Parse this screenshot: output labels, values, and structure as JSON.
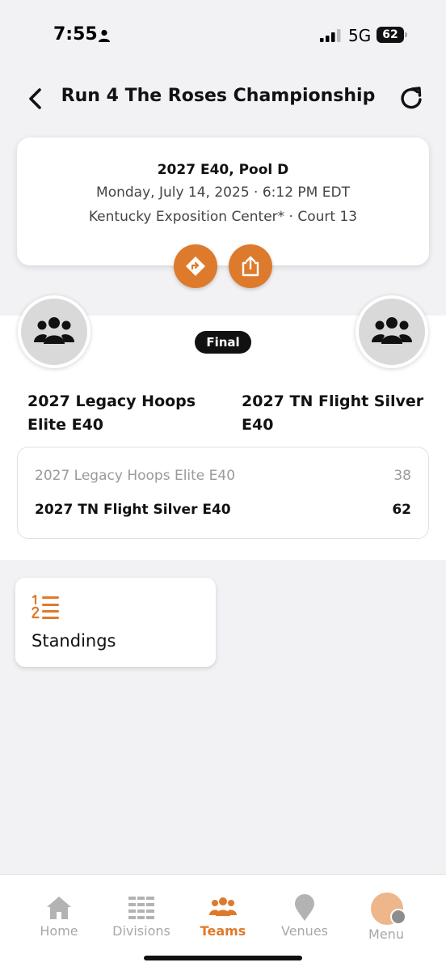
{
  "status_bar": {
    "time": "7:55",
    "network": "5G",
    "battery": "62"
  },
  "header": {
    "title": "Run 4 The Roses Championship"
  },
  "game": {
    "pool": "2027 E40, Pool D",
    "datetime": "Monday, July 14, 2025 · 6:12 PM EDT",
    "venue": "Kentucky Exposition Center* · Court 13"
  },
  "matchup": {
    "status": "Final",
    "home_team": "2027 Legacy Hoops Elite E40",
    "away_team": "2027 TN Flight Silver E40"
  },
  "scores": [
    {
      "team": "2027 Legacy Hoops Elite E40",
      "points": "38"
    },
    {
      "team": "2027 TN Flight Silver E40",
      "points": "62"
    }
  ],
  "standings": {
    "label": "Standings"
  },
  "nav": {
    "home": "Home",
    "divisions": "Divisions",
    "teams": "Teams",
    "venues": "Venues",
    "menu": "Menu"
  },
  "colors": {
    "accent": "#de7a2c",
    "background": "#f2f2f5",
    "badge": "#111111"
  }
}
